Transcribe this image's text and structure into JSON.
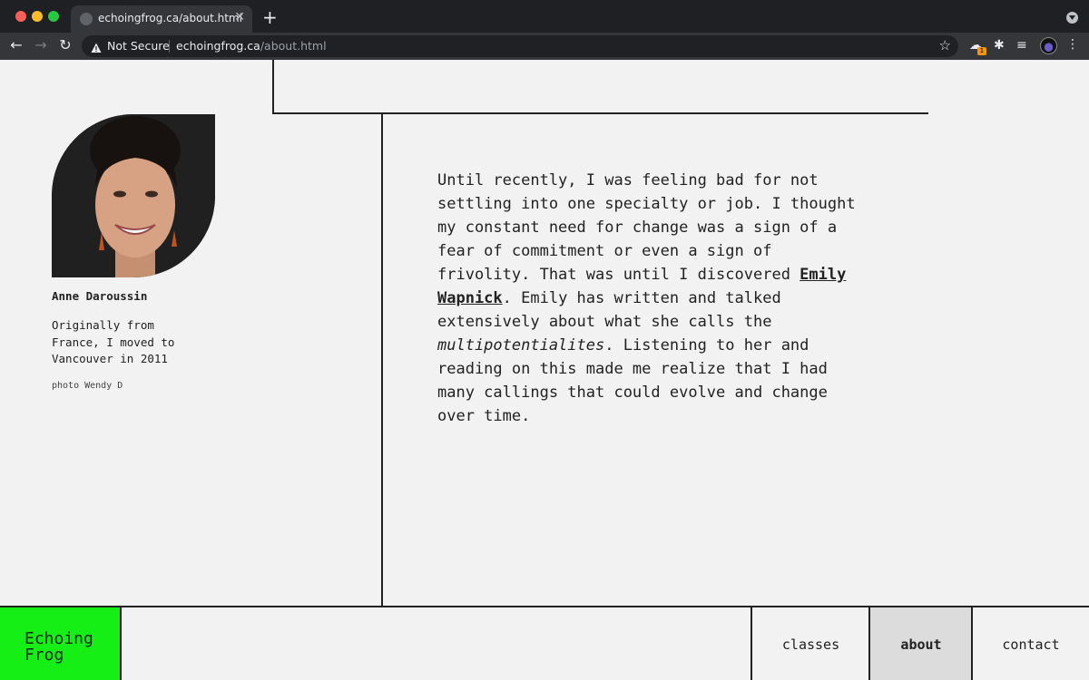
{
  "browser": {
    "tab_title": "echoingfrog.ca/about.html",
    "security_label": "Not Secure",
    "url_host": "echoingfrog.ca",
    "url_path": "/about.html",
    "extension_badge": "1"
  },
  "profile": {
    "name": "Anne Daroussin",
    "bio": "Originally from France, I moved to Vancouver in 2011",
    "photo_credit": "photo Wendy D"
  },
  "about": {
    "text_1": "Until recently, I was feeling bad for not settling into one specialty or job. I thought my constant need for change was a sign of a fear of commitment or even a sign of frivolity. That was until I discovered ",
    "link_text": "Emily Wapnick",
    "text_2": ". Emily has written and talked extensively about what she calls the ",
    "emphasis": "multipotentialites",
    "text_3": ". Listening to her and reading on this made me realize that I had many callings that could evolve and change over time."
  },
  "footer": {
    "logo": "Echoing Frog",
    "nav": [
      "classes",
      "about",
      "contact"
    ],
    "active": "about"
  },
  "colors": {
    "logo_bg": "#16ef16",
    "page_bg": "#f2f2f2",
    "active_nav_bg": "#dcdcdc"
  }
}
